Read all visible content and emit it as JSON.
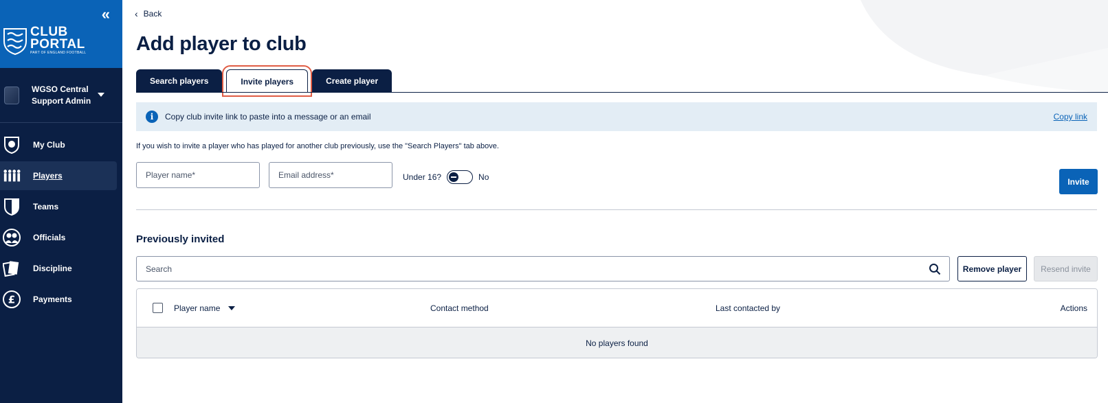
{
  "sidebar": {
    "collapse_label": "«",
    "logo": {
      "line1": "CLUB",
      "line2": "PORTAL",
      "tagline": "PART OF ENGLAND FOOTBALL"
    },
    "account": {
      "line1": "WGSO Central",
      "line2": "Support Admin"
    },
    "items": [
      {
        "label": "My Club",
        "icon": "shield-ball-icon"
      },
      {
        "label": "Players",
        "icon": "players-group-icon"
      },
      {
        "label": "Teams",
        "icon": "shield-icon"
      },
      {
        "label": "Officials",
        "icon": "officials-icon"
      },
      {
        "label": "Discipline",
        "icon": "cards-icon"
      },
      {
        "label": "Payments",
        "icon": "pound-icon"
      }
    ],
    "active_item": "Players"
  },
  "header": {
    "back_label": "Back",
    "title": "Add player to club"
  },
  "tabs": [
    {
      "label": "Search players"
    },
    {
      "label": "Invite players"
    },
    {
      "label": "Create player"
    }
  ],
  "selected_tab": "Invite players",
  "info_banner": {
    "text": "Copy club invite link to paste into a message or an email",
    "link": "Copy link"
  },
  "hint": "If you wish to invite a player who has played for another club previously, use the \"Search Players\" tab above.",
  "form": {
    "player_name_placeholder": "Player name*",
    "email_placeholder": "Email address*",
    "under16_label": "Under 16?",
    "under16_value": "No",
    "invite_button": "Invite"
  },
  "previously_invited": {
    "title": "Previously invited",
    "search_placeholder": "Search",
    "remove_button": "Remove player",
    "resend_button": "Resend invite",
    "columns": [
      "Player name",
      "Contact method",
      "Last contacted by",
      "Actions"
    ],
    "empty_text": "No players found"
  },
  "colors": {
    "navy": "#0b1f44",
    "brand_blue": "#0a63b7",
    "highlight": "#e05c44",
    "info_bg": "#e3edf5"
  }
}
